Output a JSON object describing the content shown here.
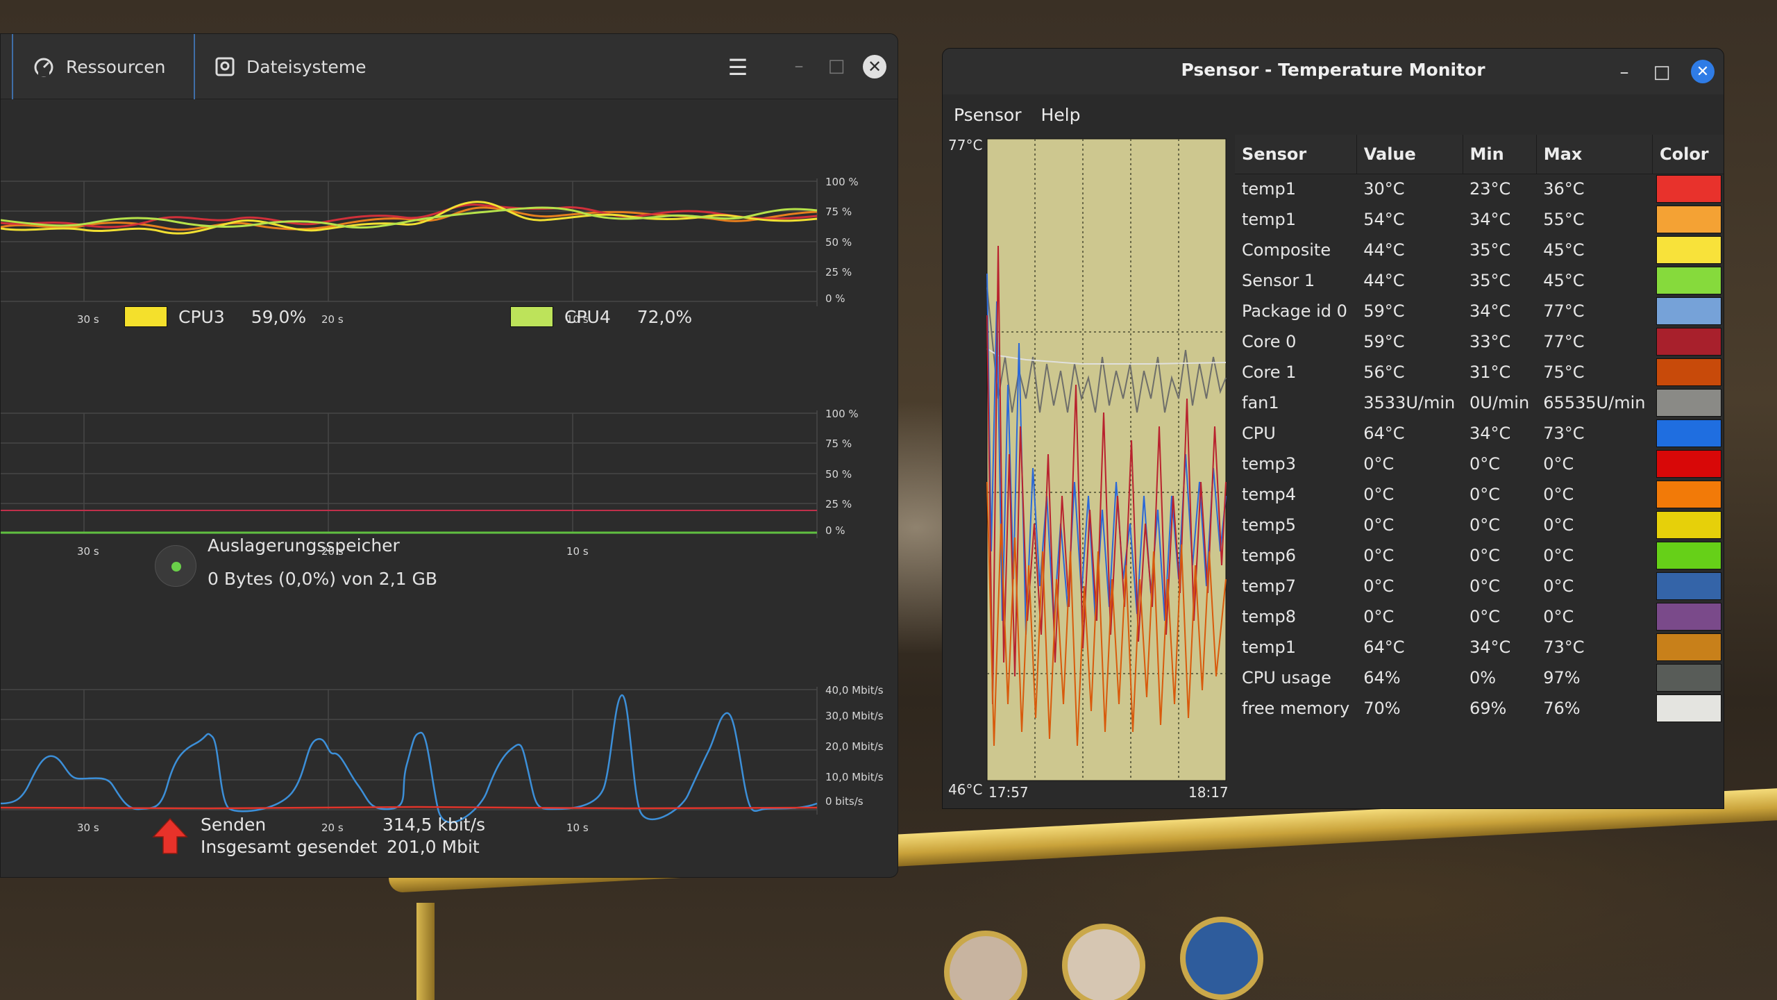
{
  "system_monitor": {
    "tabs": [
      {
        "label": "Ressourcen",
        "icon": "gauge-icon"
      },
      {
        "label": "Dateisysteme",
        "icon": "disk-icon"
      }
    ],
    "cpu_graph": {
      "y_ticks": [
        "100 %",
        "75 %",
        "50 %",
        "25 %",
        "0 %"
      ],
      "x_ticks": [
        "30 s",
        "20 s",
        "10 s"
      ],
      "series_colors": {
        "red": "#d0303a",
        "orange": "#e67f1e",
        "yellow": "#f1e032",
        "lime": "#b6e24a"
      }
    },
    "cpu_legend": [
      {
        "name": "CPU3",
        "value": "59,0%",
        "color": "#f4e02c"
      },
      {
        "name": "CPU4",
        "value": "72,0%",
        "color": "#bde35a"
      }
    ],
    "memory_graph": {
      "y_ticks": [
        "100 %",
        "75 %",
        "50 %",
        "25 %",
        "0 %"
      ],
      "x_ticks": [
        "30 s",
        "20 s",
        "10 s"
      ]
    },
    "swap": {
      "label": "Auslagerungsspeicher",
      "value": "0 Bytes (0,0%) von 2,1 GB",
      "fraction": 0.0
    },
    "network_graph": {
      "y_ticks": [
        "40,0 Mbit/s",
        "30,0 Mbit/s",
        "20,0 Mbit/s",
        "10,0 Mbit/s",
        "0 bits/s"
      ],
      "x_ticks": [
        "30 s",
        "20 s",
        "10 s"
      ],
      "receive_color": "#3c8fd8",
      "send_color": "#e0342a"
    },
    "send": {
      "label": "Senden",
      "rate": "314,5 kbit/s",
      "total_label": "Insgesamt gesendet",
      "total": "201,0 Mbit"
    }
  },
  "psensor": {
    "title": "Psensor - Temperature Monitor",
    "menu": [
      "Psensor",
      "Help"
    ],
    "graph": {
      "y_max": "77°C",
      "y_min": "46°C",
      "x_start": "17:57",
      "x_end": "18:17",
      "background": "#cdc78f"
    },
    "columns": [
      "Sensor",
      "Value",
      "Min",
      "Max",
      "Color"
    ],
    "rows": [
      {
        "sensor": "temp1",
        "value": "30°C",
        "min": "23°C",
        "max": "36°C",
        "color": "#e8322c"
      },
      {
        "sensor": "temp1",
        "value": "54°C",
        "min": "34°C",
        "max": "55°C",
        "color": "#f4a234"
      },
      {
        "sensor": "Composite",
        "value": "44°C",
        "min": "35°C",
        "max": "45°C",
        "color": "#f8e23a"
      },
      {
        "sensor": "Sensor 1",
        "value": "44°C",
        "min": "35°C",
        "max": "45°C",
        "color": "#86da3c"
      },
      {
        "sensor": "Package id 0",
        "value": "59°C",
        "min": "34°C",
        "max": "77°C",
        "color": "#76a2d8"
      },
      {
        "sensor": "Core 0",
        "value": "59°C",
        "min": "33°C",
        "max": "77°C",
        "color": "#a8202c"
      },
      {
        "sensor": "Core 1",
        "value": "56°C",
        "min": "31°C",
        "max": "75°C",
        "color": "#c84a0a"
      },
      {
        "sensor": "fan1",
        "value": "3533U/min",
        "min": "0U/min",
        "max": "65535U/min",
        "color": "#8a8a86"
      },
      {
        "sensor": "CPU",
        "value": "64°C",
        "min": "34°C",
        "max": "73°C",
        "color": "#1f6ee0"
      },
      {
        "sensor": "temp3",
        "value": "0°C",
        "min": "0°C",
        "max": "0°C",
        "color": "#d80808"
      },
      {
        "sensor": "temp4",
        "value": "0°C",
        "min": "0°C",
        "max": "0°C",
        "color": "#f27a08"
      },
      {
        "sensor": "temp5",
        "value": "0°C",
        "min": "0°C",
        "max": "0°C",
        "color": "#e6d00a"
      },
      {
        "sensor": "temp6",
        "value": "0°C",
        "min": "0°C",
        "max": "0°C",
        "color": "#66d018"
      },
      {
        "sensor": "temp7",
        "value": "0°C",
        "min": "0°C",
        "max": "0°C",
        "color": "#3464a8"
      },
      {
        "sensor": "temp8",
        "value": "0°C",
        "min": "0°C",
        "max": "0°C",
        "color": "#7a4a8a"
      },
      {
        "sensor": "temp1",
        "value": "64°C",
        "min": "34°C",
        "max": "73°C",
        "color": "#c8801a"
      },
      {
        "sensor": "CPU usage",
        "value": "64%",
        "min": "0%",
        "max": "97%",
        "color": "#585c58"
      },
      {
        "sensor": "free memory",
        "value": "70%",
        "min": "69%",
        "max": "76%",
        "color": "#e4e4e0"
      }
    ]
  }
}
